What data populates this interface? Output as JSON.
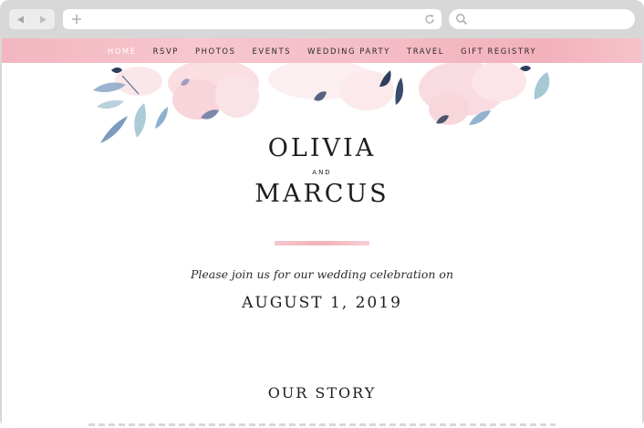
{
  "browser": {
    "back_icon": "back-arrow-icon",
    "forward_icon": "forward-arrow-icon",
    "new_tab_icon": "plus-icon",
    "reload_icon": "reload-icon",
    "search_icon": "search-icon"
  },
  "nav": {
    "items": [
      {
        "label": "HOME",
        "active": true
      },
      {
        "label": "RSVP",
        "active": false
      },
      {
        "label": "PHOTOS",
        "active": false
      },
      {
        "label": "EVENTS",
        "active": false
      },
      {
        "label": "WEDDING PARTY",
        "active": false
      },
      {
        "label": "TRAVEL",
        "active": false
      },
      {
        "label": "GIFT REGISTRY",
        "active": false
      }
    ],
    "color": "#f4bcc6"
  },
  "hero": {
    "name1": "OLIVIA",
    "and": "AND",
    "name2": "MARCUS",
    "invite": "Please join us for our wedding celebration on",
    "date": "AUGUST 1, 2019"
  },
  "story": {
    "heading": "OUR STORY"
  },
  "colors": {
    "accent_pink": "#f2b1bc",
    "floral_blue": "#7f9fc6",
    "floral_navy": "#2f3d5c",
    "text": "#1d1d1d"
  }
}
